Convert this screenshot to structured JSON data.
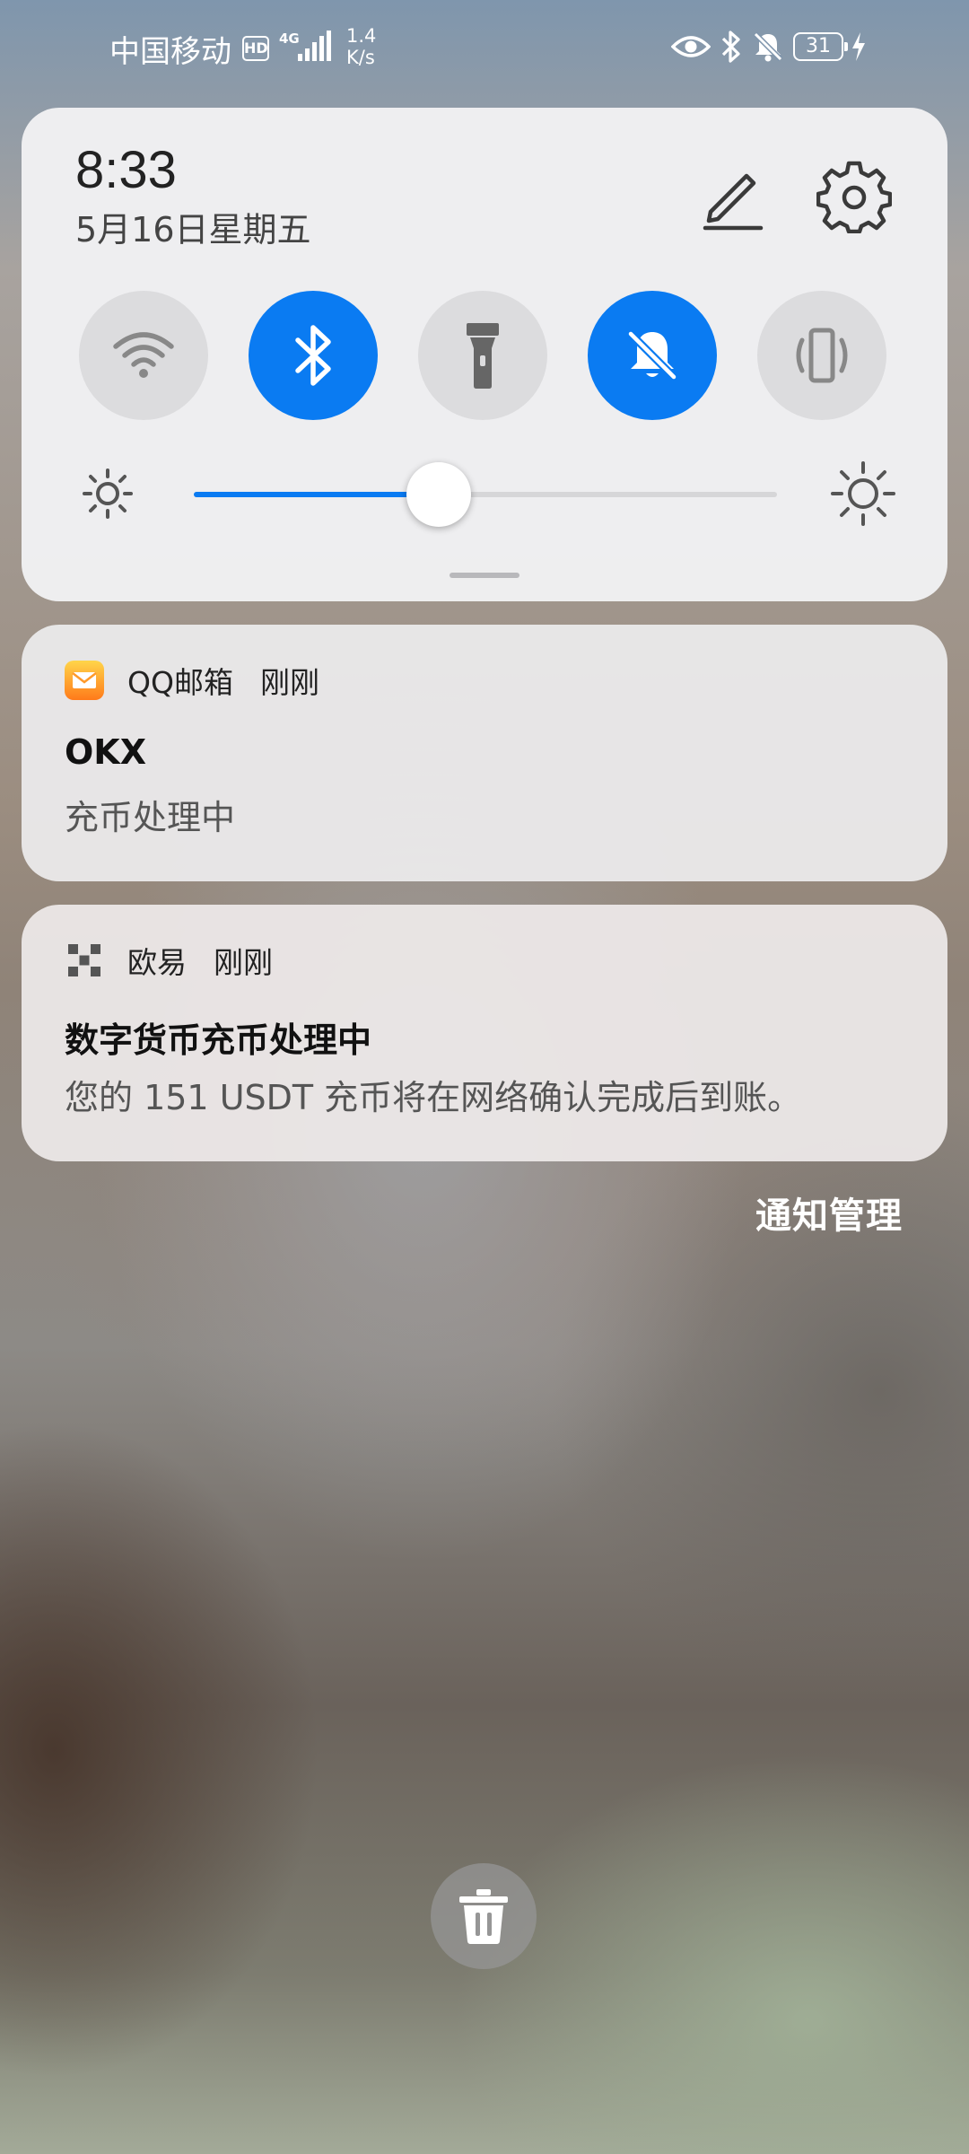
{
  "status_bar": {
    "carrier": "中国移动",
    "hd_badge": "HD",
    "network_type": "4G",
    "speed_value": "1.4",
    "speed_unit": "K/s",
    "battery_level": "31",
    "icons": [
      "eye-icon",
      "bluetooth-icon",
      "bell-off-icon",
      "battery-icon",
      "charging-icon"
    ]
  },
  "quick_settings": {
    "time": "8:33",
    "date": "5月16日星期五",
    "toggles": [
      {
        "name": "wifi",
        "icon": "wifi-icon",
        "active": false
      },
      {
        "name": "bluetooth",
        "icon": "bluetooth-icon",
        "active": true
      },
      {
        "name": "flashlight",
        "icon": "flashlight-icon",
        "active": false
      },
      {
        "name": "do-not-disturb",
        "icon": "bell-off-icon",
        "active": true
      },
      {
        "name": "vibrate",
        "icon": "vibrate-icon",
        "active": false
      }
    ],
    "brightness_level": 0.42,
    "accent_color": "#0a7bf2"
  },
  "notifications": [
    {
      "app": "QQ邮箱",
      "time": "刚刚",
      "title": "OKX",
      "text": "充币处理中",
      "icon": "qq-mail-icon"
    },
    {
      "app": "欧易",
      "time": "刚刚",
      "title": "数字货币充币处理中",
      "text": "您的 151 USDT 充币将在网络确认完成后到账。",
      "icon": "okx-icon"
    }
  ],
  "manage_label": "通知管理",
  "clear_icon": "trash-icon"
}
